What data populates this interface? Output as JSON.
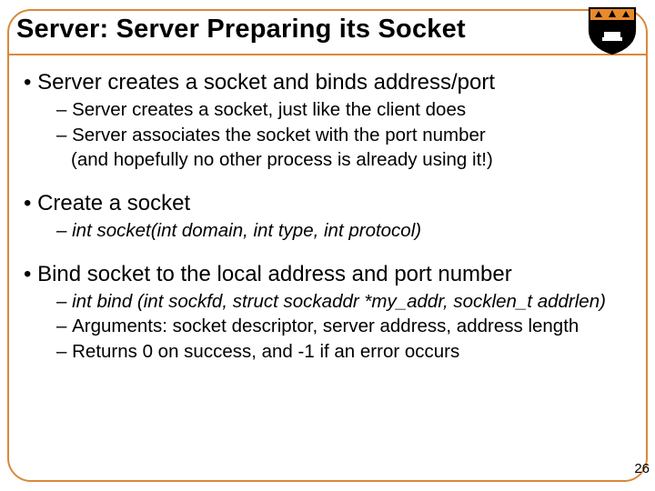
{
  "slide": {
    "title": "Server: Server Preparing its Socket",
    "page_number": "26",
    "bullets": {
      "b1_1": "Server creates a socket and binds address/port",
      "b1_1_sub1": "Server creates a socket, just like the client does",
      "b1_1_sub2": "Server associates the socket with the port number",
      "b1_1_sub2b": "(and hopefully no other process is already using it!)",
      "b1_2": "Create a socket",
      "b1_2_sub1": "int socket(int domain, int type, int protocol)",
      "b1_3": "Bind socket to the local address and port number",
      "b1_3_sub1": "int bind (int sockfd, struct sockaddr *my_addr, socklen_t addrlen)",
      "b1_3_sub2": "Arguments: socket descriptor, server address, address length",
      "b1_3_sub3": "Returns 0 on success, and -1 if an error occurs"
    }
  }
}
